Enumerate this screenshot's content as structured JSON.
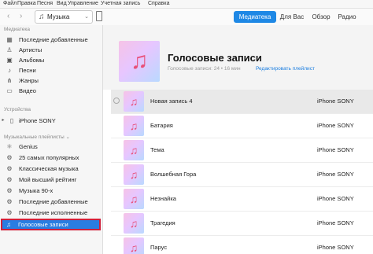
{
  "menu": [
    "Файл",
    "Правка",
    "Песня",
    "Вид",
    "Управление",
    "Учетная запись",
    "Справка"
  ],
  "toolbar": {
    "back": "‹",
    "forward": "›",
    "media_icon": "music-note-icon",
    "media_label": "Музыка",
    "chevron": "⌄"
  },
  "tabs": [
    "Медиатека",
    "Для Вас",
    "Обзор",
    "Радио"
  ],
  "sidebar": {
    "library_title": "Медиатека",
    "library": [
      {
        "icon": "clock-grid-icon",
        "glyph": "▦",
        "label": "Последние добавленные"
      },
      {
        "icon": "microphone-icon",
        "glyph": "♙",
        "label": "Артисты"
      },
      {
        "icon": "album-icon",
        "glyph": "▣",
        "label": "Альбомы"
      },
      {
        "icon": "music-note-icon",
        "glyph": "♪",
        "label": "Песни"
      },
      {
        "icon": "genres-icon",
        "glyph": "⋔",
        "label": "Жанры"
      },
      {
        "icon": "video-icon",
        "glyph": "▭",
        "label": "Видео"
      }
    ],
    "devices_title": "Устройства",
    "device": {
      "icon": "phone-icon",
      "label": "iPhone SONY"
    },
    "playlists_title": "Музыкальные плейлисты ⌄",
    "playlists": [
      {
        "icon": "genius-icon",
        "glyph": "⚛",
        "label": "Genius"
      },
      {
        "icon": "gear-icon",
        "glyph": "⚙",
        "label": "25 самых популярных"
      },
      {
        "icon": "gear-icon",
        "glyph": "⚙",
        "label": "Классическая музыка"
      },
      {
        "icon": "gear-icon",
        "glyph": "⚙",
        "label": "Мой высший рейтинг"
      },
      {
        "icon": "gear-icon",
        "glyph": "⚙",
        "label": "Музыка 90-х"
      },
      {
        "icon": "gear-icon",
        "glyph": "⚙",
        "label": "Последние добавленные"
      },
      {
        "icon": "gear-icon",
        "glyph": "⚙",
        "label": "Последние исполненные"
      }
    ],
    "selected": {
      "icon": "playlist-icon",
      "glyph": "♫",
      "label": "Голосовые записи"
    }
  },
  "playlist": {
    "title": "Голосовые записи",
    "meta": "Голосовые записи: 24 • 16 мин",
    "edit_link": "Редактировать плейлист",
    "art_icon": "music-note-icon",
    "tracks": [
      {
        "name": "Новая запись 4",
        "artist": "iPhone SONY"
      },
      {
        "name": "Батария",
        "artist": "iPhone SONY"
      },
      {
        "name": "Тема",
        "artist": "iPhone SONY"
      },
      {
        "name": "Волшебная Гора",
        "artist": "iPhone SONY"
      },
      {
        "name": "Незнайка",
        "artist": "iPhone SONY"
      },
      {
        "name": "Трагедия",
        "artist": "iPhone SONY"
      },
      {
        "name": "Парус",
        "artist": "iPhone SONY"
      }
    ]
  },
  "colors": {
    "accent": "#1e88e5",
    "selection": "#2a7de1",
    "highlight_border": "#d0203a"
  }
}
